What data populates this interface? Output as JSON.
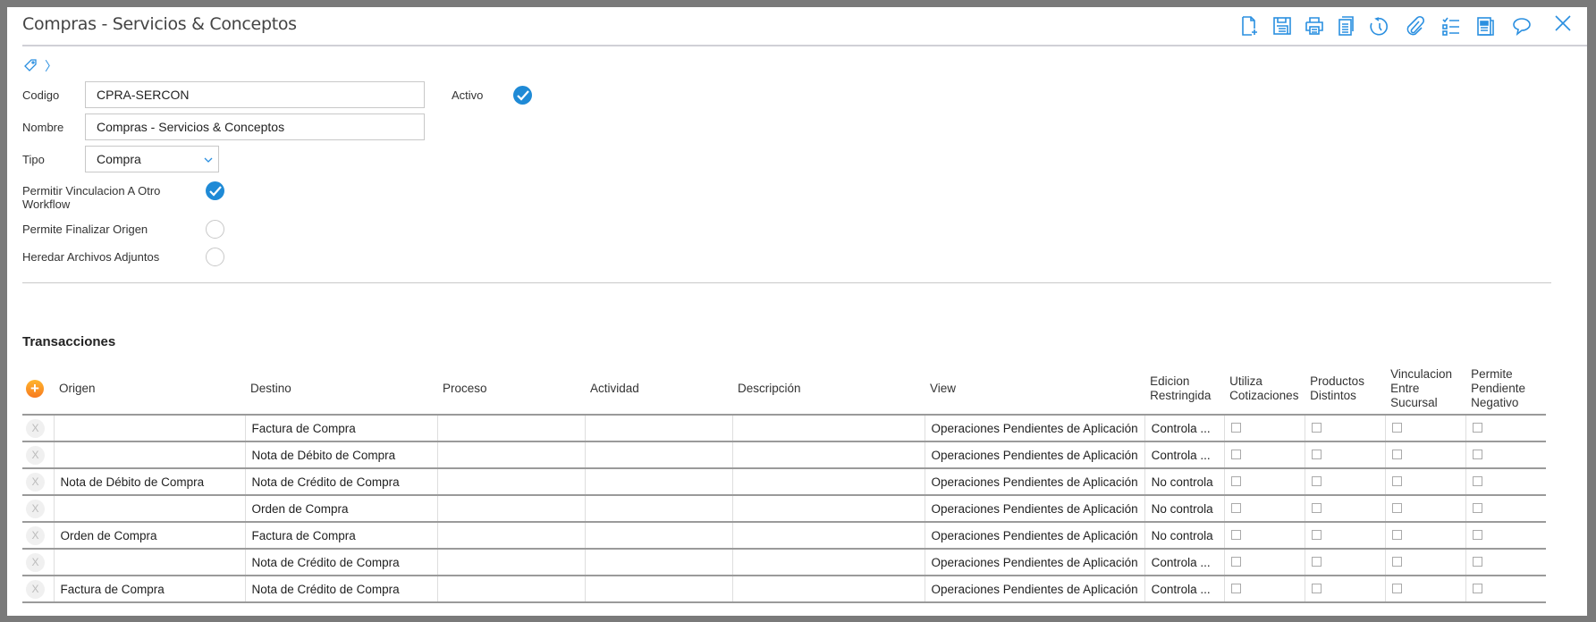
{
  "header": {
    "title": "Compras - Servicios & Conceptos",
    "toolbar": [
      "new-document",
      "save",
      "print",
      "copy",
      "history",
      "attach",
      "checklist",
      "report",
      "comment",
      "close"
    ]
  },
  "form": {
    "codigo_label": "Codigo",
    "codigo_value": "CPRA-SERCON",
    "activo_label": "Activo",
    "activo_checked": true,
    "nombre_label": "Nombre",
    "nombre_value": "Compras - Servicios & Conceptos",
    "tipo_label": "Tipo",
    "tipo_value": "Compra",
    "vinculacion_label": "Permitir Vinculacion A Otro Workflow",
    "vinculacion_checked": true,
    "finalizar_label": "Permite Finalizar Origen",
    "finalizar_checked": false,
    "heredar_label": "Heredar Archivos Adjuntos",
    "heredar_checked": false
  },
  "transacciones": {
    "title": "Transacciones",
    "delete_label": "X",
    "add_label": "+",
    "columns": [
      "Origen",
      "Destino",
      "Proceso",
      "Actividad",
      "Descripción",
      "View",
      "Edicion Restringida",
      "Utiliza Cotizaciones",
      "Productos Distintos",
      "Vinculacion Entre Sucursal",
      "Permite Pendiente Negativo"
    ],
    "rows": [
      {
        "origen": "",
        "destino": "Factura de Compra",
        "proceso": "",
        "actividad": "",
        "descripcion": "",
        "view": "Operaciones Pendientes de Aplicación",
        "edicion": "Controla ..."
      },
      {
        "origen": "",
        "destino": "Nota de Débito de Compra",
        "proceso": "",
        "actividad": "",
        "descripcion": "",
        "view": "Operaciones Pendientes de Aplicación",
        "edicion": "Controla ..."
      },
      {
        "origen": "Nota de Débito de Compra",
        "destino": "Nota de Crédito de Compra",
        "proceso": "",
        "actividad": "",
        "descripcion": "",
        "view": "Operaciones Pendientes de Aplicación",
        "edicion": "No controla"
      },
      {
        "origen": "",
        "destino": "Orden de Compra",
        "proceso": "",
        "actividad": "",
        "descripcion": "",
        "view": "Operaciones Pendientes de Aplicación",
        "edicion": "No controla"
      },
      {
        "origen": "Orden de Compra",
        "destino": "Factura de Compra",
        "proceso": "",
        "actividad": "",
        "descripcion": "",
        "view": "Operaciones Pendientes de Aplicación",
        "edicion": "No controla"
      },
      {
        "origen": "",
        "destino": "Nota de Crédito de Compra",
        "proceso": "",
        "actividad": "",
        "descripcion": "",
        "view": "Operaciones Pendientes de Aplicación",
        "edicion": "Controla ..."
      },
      {
        "origen": "Factura de Compra",
        "destino": "Nota de Crédito de Compra",
        "proceso": "",
        "actividad": "",
        "descripcion": "",
        "view": "Operaciones Pendientes de Aplicación",
        "edicion": "Controla ..."
      }
    ]
  }
}
